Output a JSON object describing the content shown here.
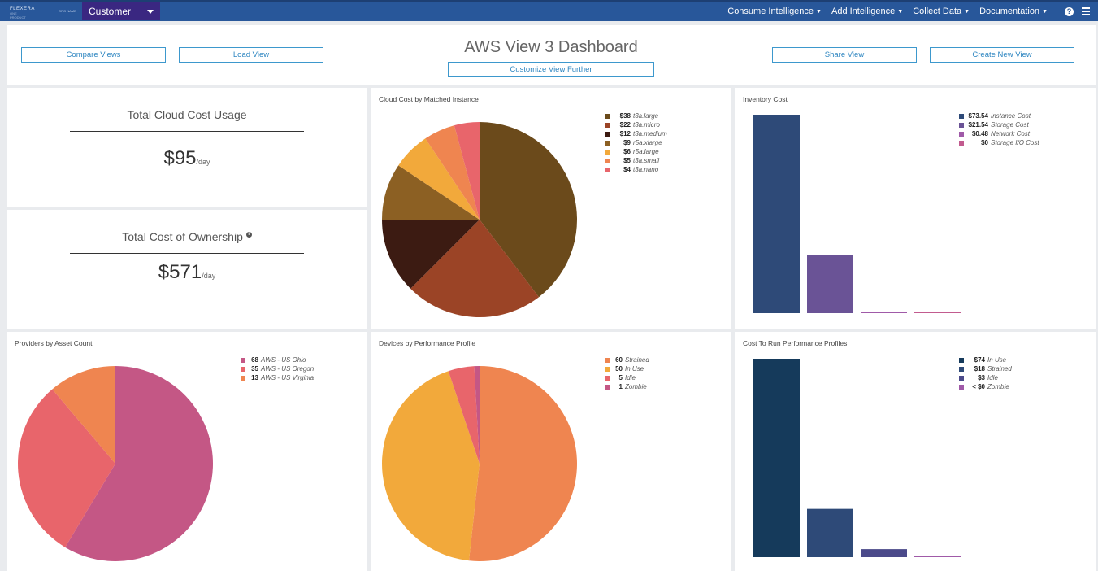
{
  "nav": {
    "logo_text": "FLEXERA",
    "logo_sub": "ONE PRODUCT",
    "logo2_text": "ORG NAME",
    "workspace": "Customer Sandbox",
    "menu": [
      {
        "label": "Consume Intelligence"
      },
      {
        "label": "Add Intelligence"
      },
      {
        "label": "Collect Data"
      },
      {
        "label": "Documentation"
      }
    ],
    "help_glyph": "?",
    "icons": {
      "help": "help-icon",
      "menu": "hamburger-menu-icon",
      "caret": "caret-down-icon"
    }
  },
  "header": {
    "title": "AWS View 3 Dashboard",
    "buttons": {
      "compare": "Compare Views",
      "load": "Load View",
      "customize": "Customize View Further",
      "share": "Share View",
      "create": "Create New View"
    }
  },
  "kpis": {
    "cloud_cost": {
      "title": "Total Cloud Cost Usage",
      "value": "$95",
      "unit": "/day"
    },
    "tco": {
      "title": "Total Cost of Ownership",
      "value": "$571",
      "unit": "/day",
      "info_glyph": "i"
    }
  },
  "panels": {
    "cloud_cost_instance": {
      "title": "Cloud Cost by Matched Instance"
    },
    "inventory_cost": {
      "title": "Inventory Cost"
    },
    "providers": {
      "title": "Providers by Asset Count"
    },
    "devices": {
      "title": "Devices by Performance Profile"
    },
    "run_cost": {
      "title": "Cost To Run Performance Profiles"
    }
  },
  "chart_data": [
    {
      "id": "cloud_cost_instance",
      "type": "pie",
      "title": "Cloud Cost by Matched Instance",
      "slices": [
        {
          "label": "t3a.large",
          "value": 38,
          "display": "$38",
          "color": "#6b4a1b"
        },
        {
          "label": "t3a.micro",
          "value": 22,
          "display": "$22",
          "color": "#9b4426"
        },
        {
          "label": "t3a.medium",
          "value": 12,
          "display": "$12",
          "color": "#3c1b12"
        },
        {
          "label": "r5a.xlarge",
          "value": 9,
          "display": "$9",
          "color": "#8c6023"
        },
        {
          "label": "r5a.large",
          "value": 6,
          "display": "$6",
          "color": "#f2a93b"
        },
        {
          "label": "t3a.small",
          "value": 5,
          "display": "$5",
          "color": "#ef8550"
        },
        {
          "label": "t3a.nano",
          "value": 4,
          "display": "$4",
          "color": "#e8656b"
        }
      ]
    },
    {
      "id": "inventory_cost",
      "type": "bar",
      "title": "Inventory Cost",
      "categories": [
        "Instance Cost",
        "Storage Cost",
        "Network Cost",
        "Storage I/O Cost"
      ],
      "values": [
        73.54,
        21.54,
        0.48,
        0
      ],
      "display": [
        "$73.54",
        "$21.54",
        "$0.48",
        "$0"
      ],
      "colors": [
        "#2e4a78",
        "#6a5396",
        "#a05aa8",
        "#c25b8f"
      ],
      "ylim": [
        0,
        73.54
      ],
      "grid": false,
      "legend": "top-right"
    },
    {
      "id": "providers",
      "type": "pie",
      "title": "Providers by Asset Count",
      "slices": [
        {
          "label": "AWS - US Ohio",
          "value": 68,
          "display": "68",
          "color": "#c45785"
        },
        {
          "label": "AWS - US Oregon",
          "value": 35,
          "display": "35",
          "color": "#e8656b"
        },
        {
          "label": "AWS - US Virginia",
          "value": 13,
          "display": "13",
          "color": "#ef8550"
        }
      ]
    },
    {
      "id": "devices",
      "type": "pie",
      "title": "Devices by Performance Profile",
      "slices": [
        {
          "label": "Strained",
          "value": 60,
          "display": "60",
          "color": "#ef8550"
        },
        {
          "label": "In Use",
          "value": 50,
          "display": "50",
          "color": "#f2a93b"
        },
        {
          "label": "Idle",
          "value": 5,
          "display": "5",
          "color": "#e8656b"
        },
        {
          "label": "Zombie",
          "value": 1,
          "display": "1",
          "color": "#c45785"
        }
      ]
    },
    {
      "id": "run_cost",
      "type": "bar",
      "title": "Cost To Run Performance Profiles",
      "categories": [
        "In Use",
        "Strained",
        "Idle",
        "Zombie"
      ],
      "values": [
        74,
        18,
        3,
        0.3
      ],
      "display": [
        "$74",
        "$18",
        "$3",
        "< $0"
      ],
      "colors": [
        "#153a5b",
        "#2e4a78",
        "#4b4a8a",
        "#a05aa8"
      ],
      "ylim": [
        0,
        74
      ],
      "grid": false,
      "legend": "top-right"
    }
  ]
}
